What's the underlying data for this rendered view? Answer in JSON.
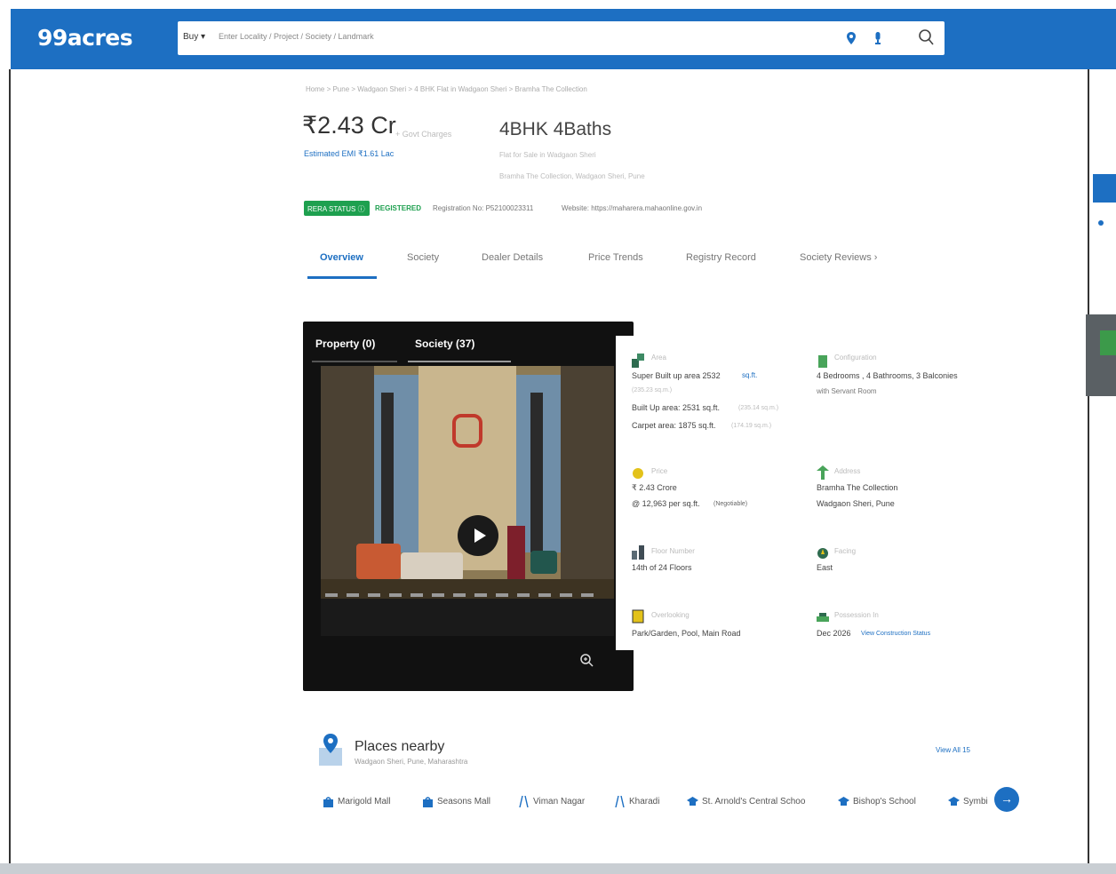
{
  "header": {
    "logo": "99acres",
    "buy_label": "Buy ▾",
    "search_placeholder": "Enter Locality / Project / Society / Landmark"
  },
  "listing": {
    "breadcrumb": "Home > Pune > Wadgaon Sheri > 4 BHK Flat in Wadgaon Sheri > Bramha The Collection",
    "price": "₹2.43 Cr",
    "price_sub": "+ Govt Charges",
    "emi": "Estimated EMI ₹1.61 Lac",
    "config_title": "4BHK 4Baths",
    "config_sub1": "Flat for Sale in Wadgaon Sheri",
    "config_sub2": "Bramha The Collection, Wadgaon Sheri, Pune",
    "rera_status": "RERA STATUS",
    "rera_registered": "REGISTERED",
    "rera_regno": "Registration No: P52100023311",
    "rera_website": "Website: https://maharera.mahaonline.gov.in"
  },
  "tabs": [
    {
      "label": "Overview"
    },
    {
      "label": "Society"
    },
    {
      "label": "Dealer Details"
    },
    {
      "label": "Price Trends"
    },
    {
      "label": "Registry Record"
    },
    {
      "label": "Society Reviews  ›"
    }
  ],
  "media": {
    "tab_property": "Property (0)",
    "tab_society": "Society (37)"
  },
  "details": {
    "area_label": "Area",
    "area_super": "Super Built up area 2532",
    "area_unit": "sq.ft.",
    "area_super_sqm": "(235.23 sq.m.)",
    "area_built": "Built Up area: 2531 sq.ft.",
    "area_built_sqm": "(235.14 sq.m.)",
    "area_carpet": "Carpet area: 1875 sq.ft.",
    "area_carpet_sqm": "(174.19 sq.m.)",
    "config_label": "Configuration",
    "config_val1": "4 Bedrooms , 4 Bathrooms, 3 Balconies",
    "config_val2": "with Servant Room",
    "price_label": "Price",
    "price_val1": "₹ 2.43 Crore",
    "price_val2": "@ 12,963 per sq.ft.",
    "price_negotiable": "(Negotiable)",
    "address_label": "Address",
    "address_val1": "Bramha The Collection",
    "address_val2": "Wadgaon Sheri, Pune",
    "floor_label": "Floor Number",
    "floor_val": "14th of 24 Floors",
    "facing_label": "Facing",
    "facing_val": "East",
    "overlooking_label": "Overlooking",
    "overlooking_val": "Park/Garden, Pool, Main Road",
    "possession_label": "Possession In",
    "possession_val": "Dec 2026",
    "possession_link": "View Construction Status"
  },
  "nearby": {
    "title": "Places nearby",
    "subtitle": "Wadgaon Sheri, Pune, Maharashtra",
    "view_all": "View All 15",
    "places": [
      {
        "label": "Marigold Mall",
        "icon": "mall-icon"
      },
      {
        "label": "Seasons Mall",
        "icon": "mall-icon"
      },
      {
        "label": "Viman Nagar",
        "icon": "locality-icon"
      },
      {
        "label": "Kharadi",
        "icon": "locality-icon"
      },
      {
        "label": "St. Arnold's Central Schoo",
        "icon": "school-icon"
      },
      {
        "label": "Bishop's School",
        "icon": "school-icon"
      },
      {
        "label": "Symbi",
        "icon": "school-icon"
      }
    ]
  },
  "colors": {
    "brand_blue": "#1d6fc2",
    "rera_green": "#1ea04f"
  }
}
